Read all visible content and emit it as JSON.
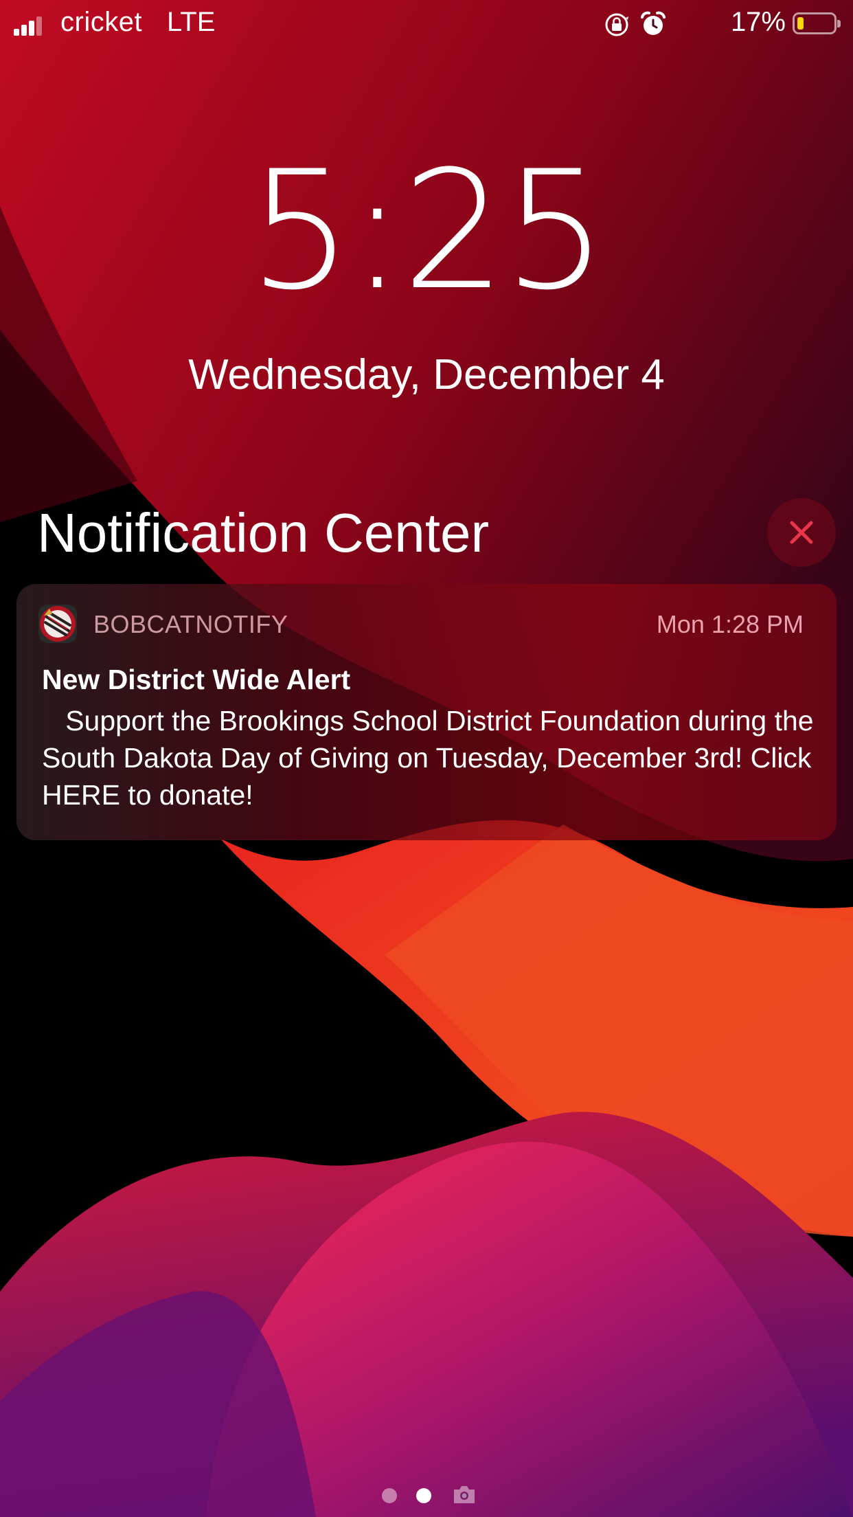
{
  "status_bar": {
    "carrier": "cricket",
    "network": "LTE",
    "battery_percent": "17%",
    "battery_level": 0.17,
    "battery_color": "#ffd60a",
    "icons": [
      "signal-icon",
      "orientation-lock-icon",
      "alarm-icon",
      "battery-icon"
    ]
  },
  "lock_screen": {
    "time": "5:25",
    "date": "Wednesday, December 4"
  },
  "notification_center": {
    "title": "Notification Center",
    "clear_icon": "close-icon",
    "notifications": [
      {
        "app_name": "BOBCATNOTIFY",
        "time": "Mon 1:28 PM",
        "title": "New District Wide Alert",
        "body": "   Support the Brookings School District Foundation during the South Dakota Day of Giving on Tuesday, December 3rd! Click HERE to donate!"
      }
    ]
  },
  "page_indicator": {
    "pages": 3,
    "current": 2,
    "last_icon": "camera-icon"
  },
  "colors": {
    "accent": "#e8364a",
    "wallpaper_red": "#b0061c",
    "wallpaper_orange": "#f0451f",
    "wallpaper_magenta": "#c2186b"
  }
}
